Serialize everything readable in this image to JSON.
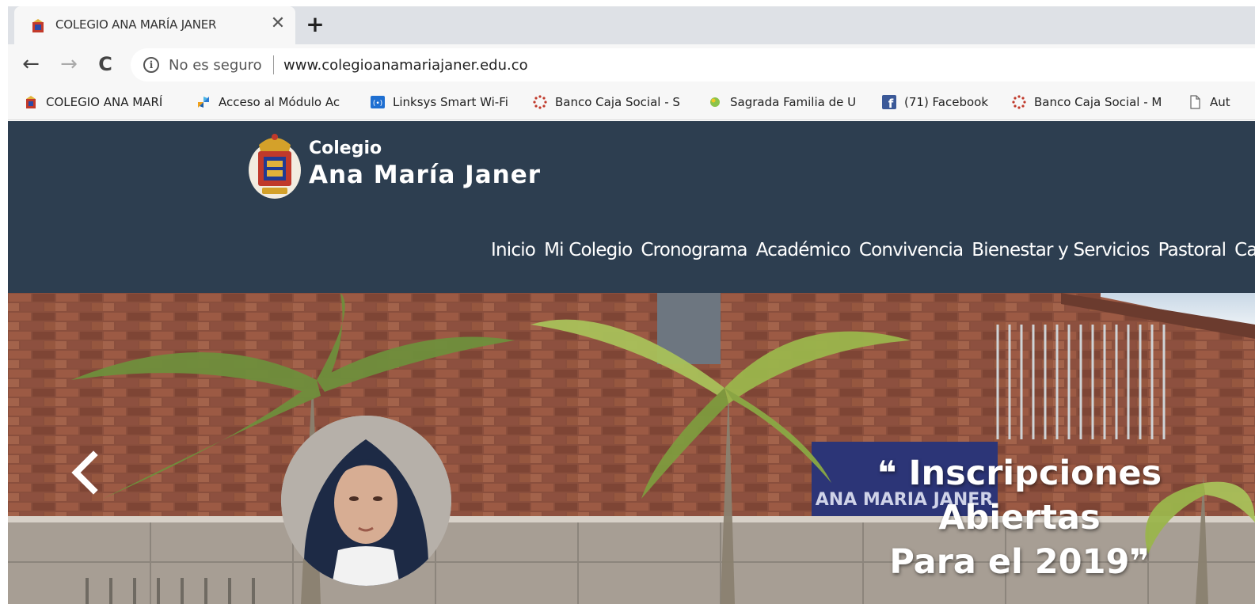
{
  "tab": {
    "title": "COLEGIO ANA MARÍA JANER",
    "close": "✕",
    "new_tab": "+"
  },
  "nav": {
    "back": "←",
    "forward": "→",
    "reload": "C"
  },
  "omnibox": {
    "info": "i",
    "security": "No es seguro",
    "url": "www.colegioanamariajaner.edu.co"
  },
  "bookmarks": [
    {
      "label": "COLEGIO ANA MARÍ",
      "icon": "crest-icon"
    },
    {
      "label": "Acceso al Módulo Ac",
      "icon": "pinwheel-icon"
    },
    {
      "label": "Linksys Smart Wi-Fi",
      "icon": "wifi-icon"
    },
    {
      "label": "Banco Caja Social - S",
      "icon": "bank-spinner-icon"
    },
    {
      "label": "Sagrada Familia de U",
      "icon": "globe-icon"
    },
    {
      "label": "(71) Facebook",
      "icon": "facebook-icon"
    },
    {
      "label": "Banco Caja Social - M",
      "icon": "bank-spinner-icon"
    },
    {
      "label": "Aut",
      "icon": "page-icon"
    }
  ],
  "site": {
    "brand_small": "Colegio",
    "brand_big": "Ana María Janer",
    "menu": [
      "Inicio",
      "Mi Colegio",
      "Cronograma",
      "Académico",
      "Convivencia",
      "Bienestar y Servicios",
      "Pastoral",
      "Cam"
    ]
  },
  "hero": {
    "caption_line1": "Inscripciones Abiertas",
    "caption_line2": "Para el 2019",
    "quote_open": "❝",
    "quote_close": "❞",
    "sign_text": "ANA MARIA JANER"
  },
  "colors": {
    "header_bg": "#2d3e50",
    "chrome_bg": "#dee1e6",
    "toolbar_bg": "#f7f7f7"
  }
}
